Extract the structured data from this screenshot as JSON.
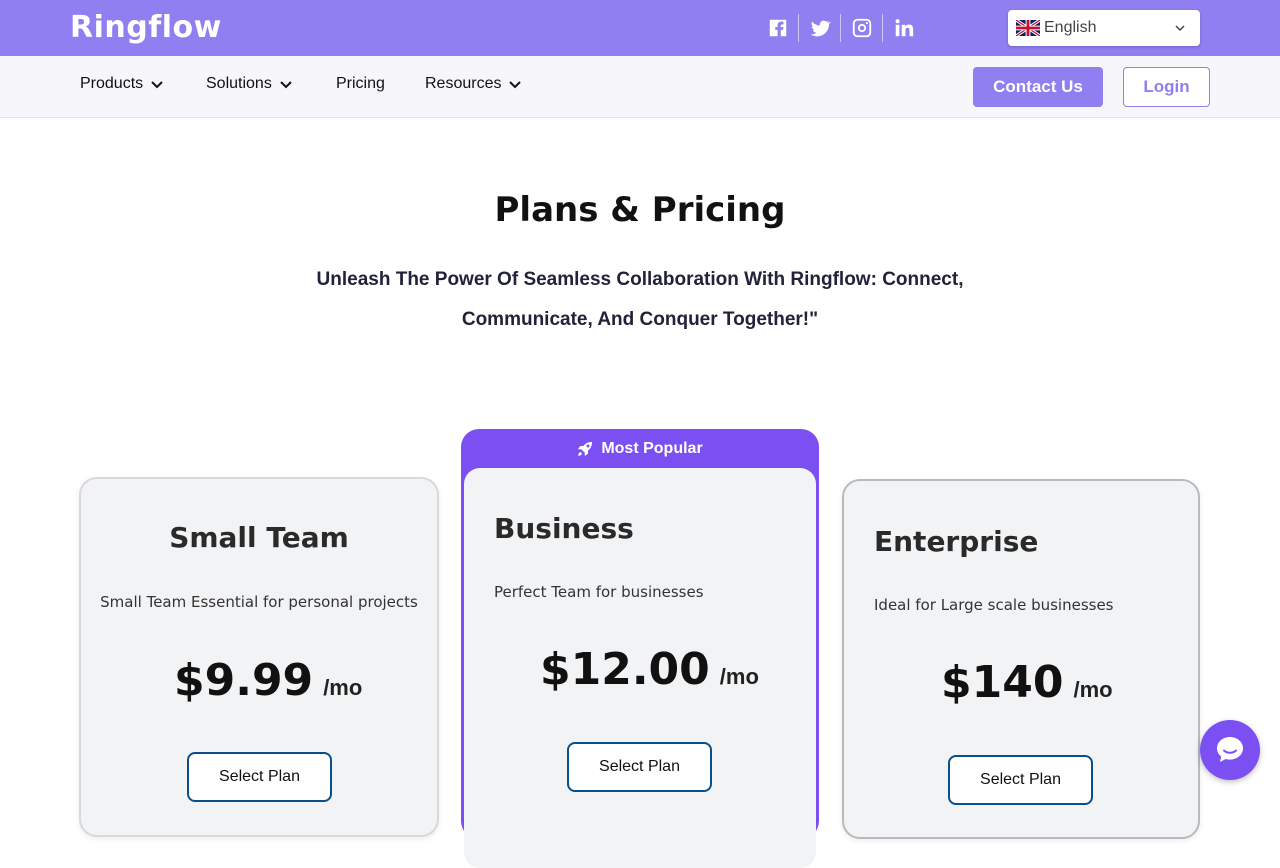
{
  "brand": {
    "logo_text": "Ringflow",
    "accent": "#8f7ff0",
    "popular": "#7c4ff2",
    "button_border": "#0b4f8a"
  },
  "topbar": {
    "social": [
      "facebook-icon",
      "twitter-icon",
      "instagram-icon",
      "linkedin-icon"
    ],
    "language": {
      "selected": "English",
      "flag": "uk-flag-icon"
    }
  },
  "nav": {
    "items": [
      {
        "label": "Products",
        "dropdown": true
      },
      {
        "label": "Solutions",
        "dropdown": true
      },
      {
        "label": "Pricing",
        "dropdown": false
      },
      {
        "label": "Resources",
        "dropdown": true
      }
    ],
    "contact_label": "Contact Us",
    "login_label": "Login"
  },
  "hero": {
    "title": "Plans & Pricing",
    "subtitle": "Unleash The Power Of Seamless Collaboration With Ringflow: Connect, Communicate, And Conquer Together!\""
  },
  "plans": [
    {
      "name": "Small Team",
      "description": "Small Team Essential for personal projects",
      "price": "$9.99",
      "period": "/mo",
      "button": "Select Plan"
    },
    {
      "name": "Business",
      "description": "Perfect Team for businesses",
      "price": "$12.00",
      "period": "/mo",
      "button": "Select Plan",
      "badge": "Most Popular"
    },
    {
      "name": "Enterprise",
      "description": "Ideal for Large scale businesses",
      "price": "$140",
      "period": "/mo",
      "button": "Select Plan"
    }
  ],
  "chat": {
    "icon": "chat-icon"
  }
}
